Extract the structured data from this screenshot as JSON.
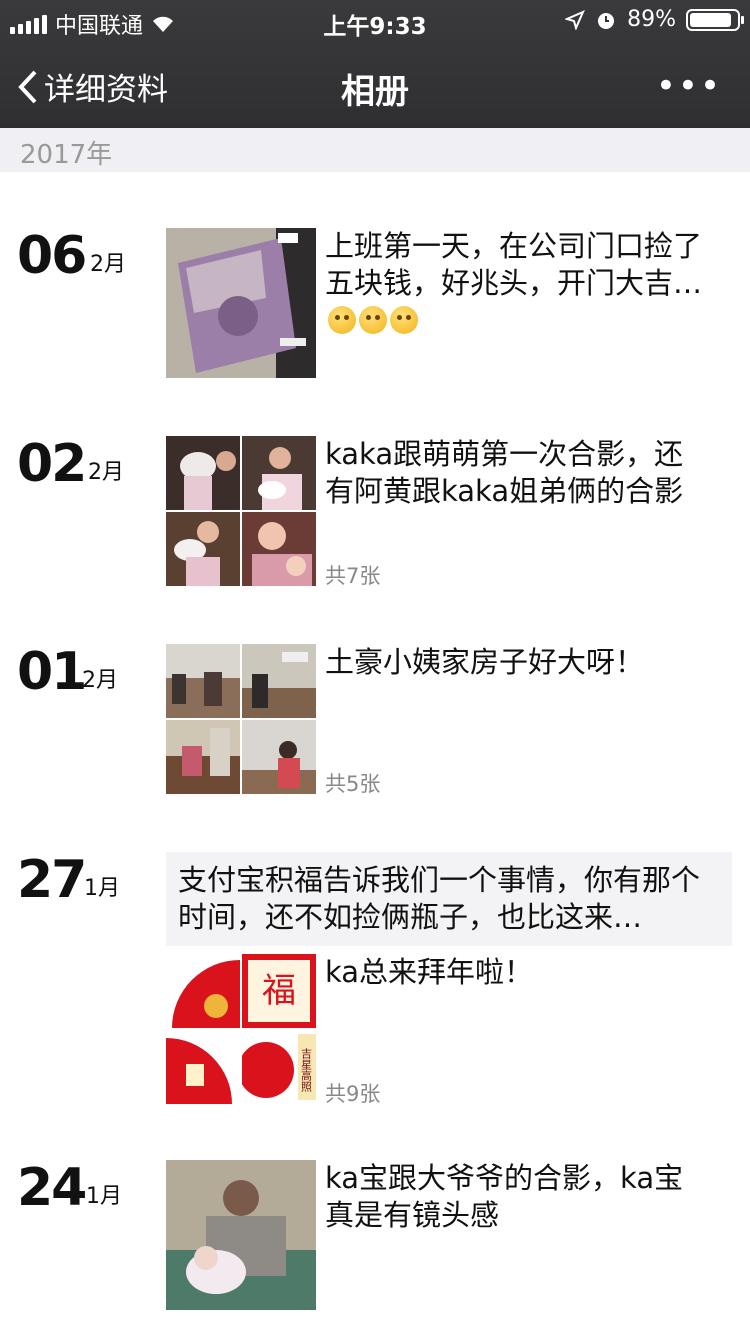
{
  "status_bar": {
    "carrier": "中国联通",
    "time": "上午9:33",
    "battery": "89%",
    "battery_level": 0.89
  },
  "nav": {
    "back_label": "详细资料",
    "title": "相册",
    "more": "•••"
  },
  "year_label": "2017年",
  "posts": [
    {
      "day": "06",
      "month": "2月",
      "text": "上班第一天，在公司门口捡了五块钱，好兆头，开门大吉…",
      "emoji": [
        "thinking-emoji",
        "thinking-emoji",
        "thinking-emoji"
      ]
    },
    {
      "day": "02",
      "month": "2月",
      "text": "kaka跟萌萌第一次合影，还有阿黄跟kaka姐弟俩的合影",
      "count": "共7张"
    },
    {
      "day": "01",
      "month": "2月",
      "text": "土豪小姨家房子好大呀！",
      "count": "共5张"
    },
    {
      "day": "27",
      "month": "1月",
      "share_text": "支付宝积福告诉我们一个事情，你有那个时间，还不如捡俩瓶子，也比这来…",
      "text": "ka总来拜年啦！",
      "count": "共9张",
      "image_text": {
        "fu": "福",
        "card": "吉星高照"
      }
    },
    {
      "day": "24",
      "month": "1月",
      "text": "ka宝跟大爷爷的合影，ka宝真是有镜头感"
    }
  ]
}
